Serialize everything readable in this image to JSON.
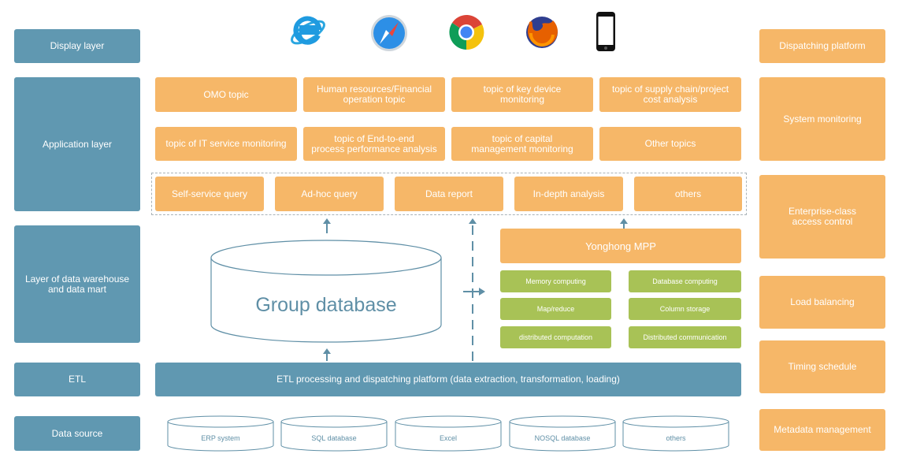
{
  "left_layers": [
    "Display layer",
    "Application layer",
    "Layer of data warehouse\nand data mart",
    "ETL",
    "Data source"
  ],
  "right_services": [
    "Dispatching platform",
    "System monitoring",
    "Enterprise-class\naccess control",
    "Load balancing",
    "Timing schedule",
    "Metadata management"
  ],
  "display_icons": [
    "internet-explorer-icon",
    "safari-icon",
    "chrome-icon",
    "firefox-icon",
    "mobile-phone-icon"
  ],
  "topics": [
    "OMO topic",
    "Human resources/Financial\noperation topic",
    "topic of key device\nmonitoring",
    "topic of supply chain/project\ncost analysis",
    "topic of IT service monitoring",
    "topic of End-to-end\nprocess performance analysis",
    "topic of capital\nmanagement monitoring",
    "Other topics"
  ],
  "analysis_tools": [
    "Self-service query",
    "Ad-hoc query",
    "Data report",
    "In-depth analysis",
    "others"
  ],
  "group_database": "Group database",
  "mpp": {
    "title": "Yonghong MPP",
    "features": [
      "Memory computing",
      "Database computing",
      "Map/reduce",
      "Column storage",
      "distributed computation",
      "Distributed communication"
    ]
  },
  "etl_platform": "ETL processing and dispatching platform (data extraction, transformation, loading)",
  "data_sources": [
    "ERP system",
    "SQL database",
    "Excel",
    "NOSQL database",
    "others"
  ],
  "colors": {
    "blue": "#6098b1",
    "orange": "#f6b768",
    "green": "#a8c256",
    "outline": "#5f8fa6"
  }
}
